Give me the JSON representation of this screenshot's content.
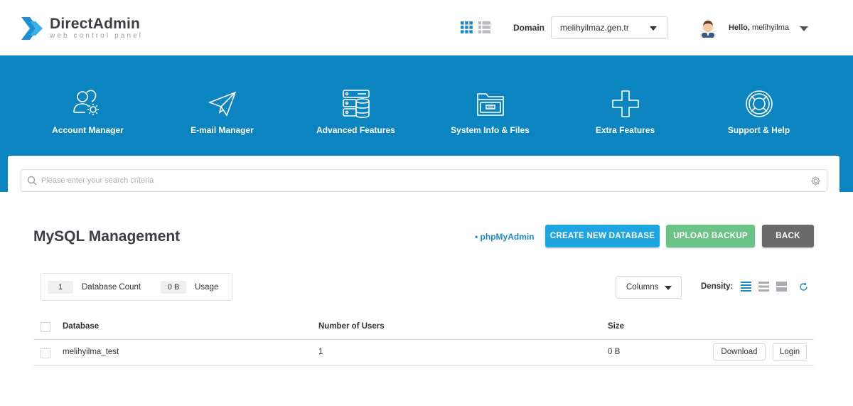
{
  "header": {
    "logo_title": "DirectAdmin",
    "logo_subtitle": "web control panel",
    "domain_label": "Domain",
    "domain_value": "melihyilmaz.gen.tr",
    "hello_prefix": "Hello,",
    "username": "melihyilma"
  },
  "nav": {
    "items": [
      {
        "label": "Account Manager",
        "icon": "users-gear-icon"
      },
      {
        "label": "E-mail Manager",
        "icon": "paper-plane-icon"
      },
      {
        "label": "Advanced Features",
        "icon": "server-database-icon"
      },
      {
        "label": "System Info & Files",
        "icon": "folder-icon"
      },
      {
        "label": "Extra Features",
        "icon": "plus-icon"
      },
      {
        "label": "Support & Help",
        "icon": "lifebuoy-icon"
      }
    ]
  },
  "search": {
    "placeholder": "Please enter your search criteria"
  },
  "page": {
    "title": "MySQL Management",
    "phpmyadmin_link": "• phpMyAdmin",
    "create_button": "CREATE NEW DATABASE",
    "upload_button": "UPLOAD BACKUP",
    "back_button": "BACK"
  },
  "stats": {
    "db_count": "1",
    "db_count_label": "Database Count",
    "usage": "0 B",
    "usage_label": "Usage"
  },
  "toolbar": {
    "columns_label": "Columns",
    "density_label": "Density:"
  },
  "table": {
    "headers": [
      "Database",
      "Number of Users",
      "Size"
    ],
    "rows": [
      {
        "database": "melihyilma_test",
        "users": "1",
        "size": "0 B",
        "download": "Download",
        "login": "Login"
      }
    ]
  },
  "colors": {
    "nav_bg": "#0c84c0",
    "primary": "#1fa6e0",
    "success": "#6cc387",
    "secondary": "#6a6a6a",
    "link": "#1e88c7"
  }
}
